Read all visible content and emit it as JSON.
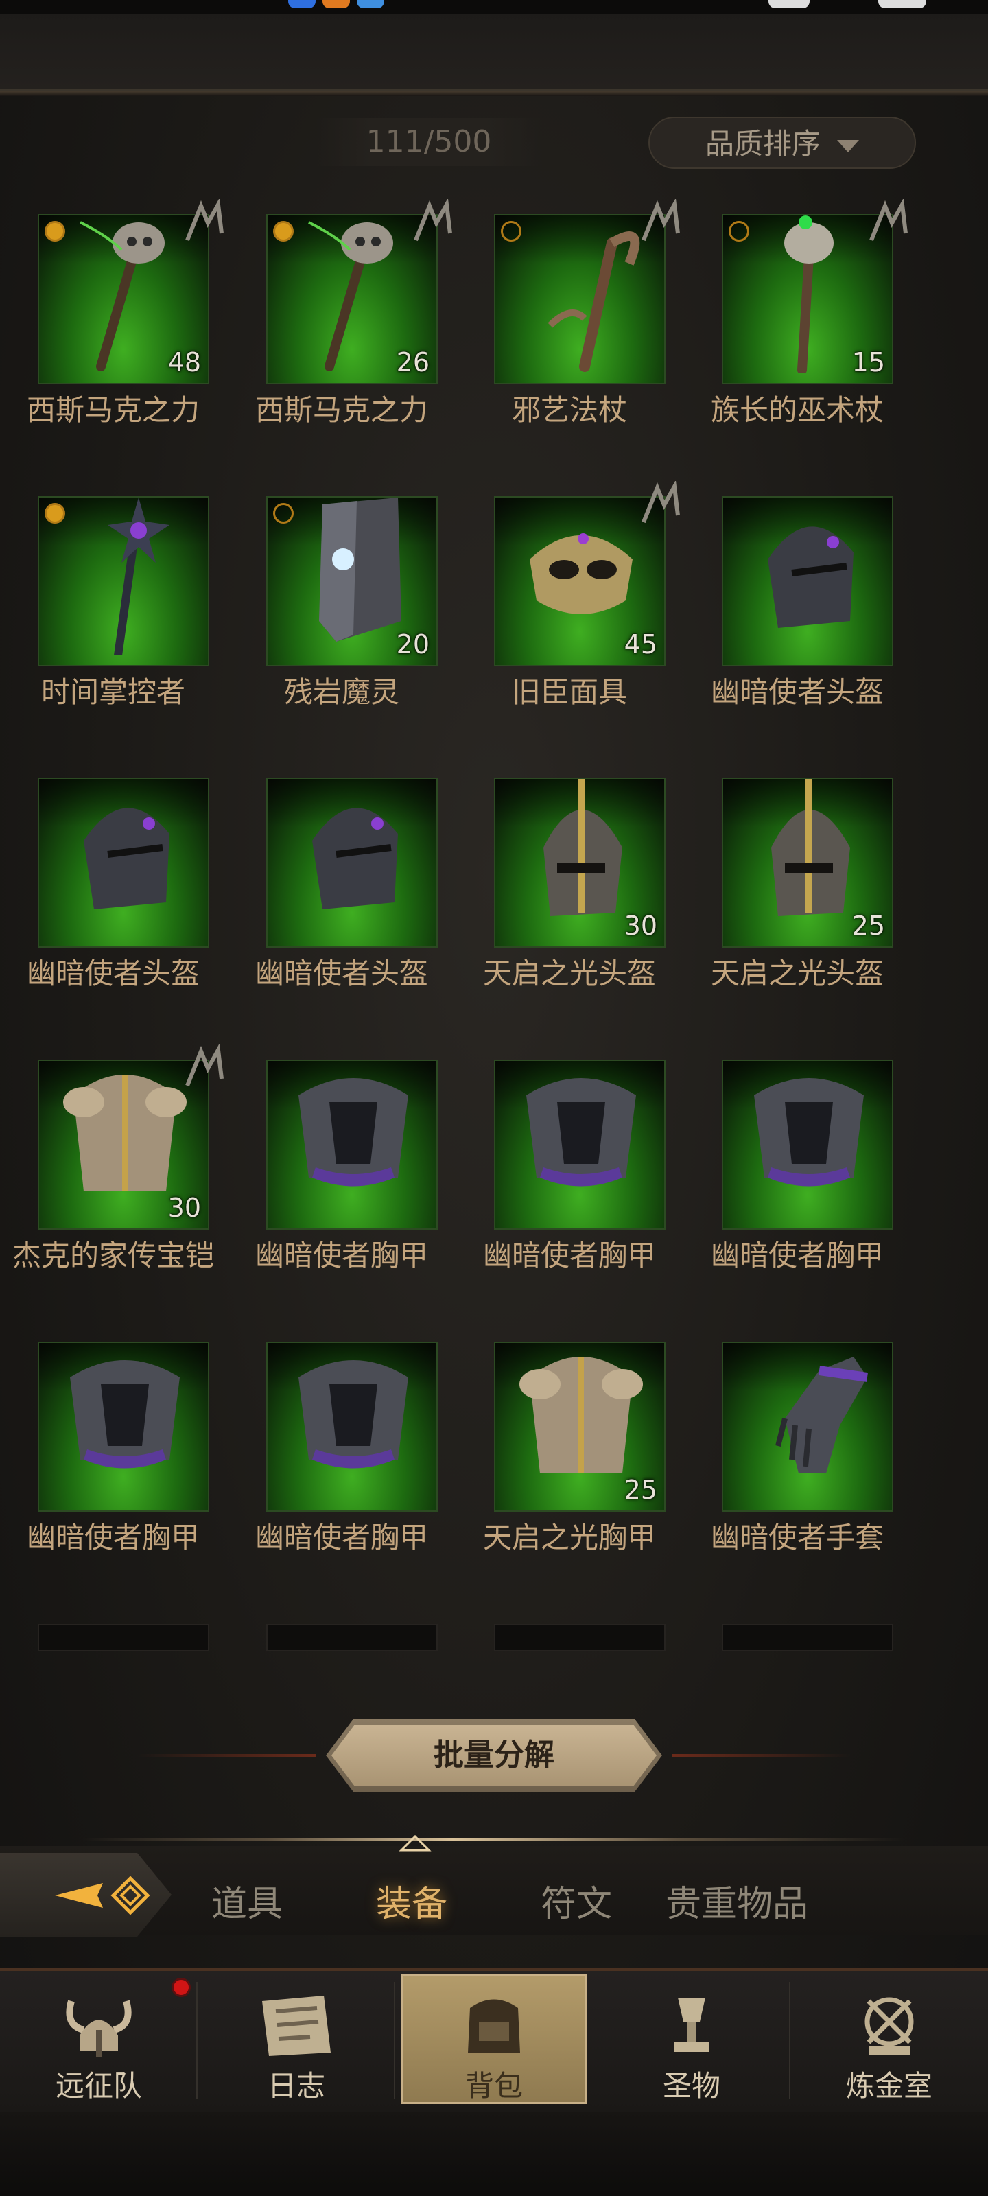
{
  "header": {
    "count_text": "111/500",
    "sort_label": "品质排序"
  },
  "items": [
    {
      "name": "西斯马克之力",
      "level": "48",
      "art": "staff-skull",
      "corner": "filled",
      "rune": true
    },
    {
      "name": "西斯马克之力",
      "level": "26",
      "art": "staff-skull",
      "corner": "filled",
      "rune": true
    },
    {
      "name": "邪艺法杖",
      "level": "",
      "art": "staff-claw",
      "corner": "empty",
      "rune": true
    },
    {
      "name": "族长的巫术杖",
      "level": "15",
      "art": "staff-orb",
      "corner": "empty",
      "rune": true
    },
    {
      "name": "时间掌控者",
      "level": "",
      "art": "staff-star",
      "corner": "filled",
      "rune": false
    },
    {
      "name": "残岩魔灵",
      "level": "20",
      "art": "shield",
      "corner": "empty",
      "rune": false
    },
    {
      "name": "旧臣面具",
      "level": "45",
      "art": "mask",
      "corner": "",
      "rune": true
    },
    {
      "name": "幽暗使者头盔",
      "level": "",
      "art": "helm-dark",
      "corner": "",
      "rune": false
    },
    {
      "name": "幽暗使者头盔",
      "level": "",
      "art": "helm-dark",
      "corner": "",
      "rune": false
    },
    {
      "name": "幽暗使者头盔",
      "level": "",
      "art": "helm-dark",
      "corner": "",
      "rune": false
    },
    {
      "name": "天启之光头盔",
      "level": "30",
      "art": "helm-gold",
      "corner": "",
      "rune": false
    },
    {
      "name": "天启之光头盔",
      "level": "25",
      "art": "helm-gold",
      "corner": "",
      "rune": false
    },
    {
      "name": "杰克的家传宝铠",
      "level": "30",
      "art": "armor-gold",
      "corner": "",
      "rune": true
    },
    {
      "name": "幽暗使者胸甲",
      "level": "",
      "art": "armor-dark",
      "corner": "",
      "rune": false
    },
    {
      "name": "幽暗使者胸甲",
      "level": "",
      "art": "armor-dark",
      "corner": "",
      "rune": false
    },
    {
      "name": "幽暗使者胸甲",
      "level": "",
      "art": "armor-dark",
      "corner": "",
      "rune": false
    },
    {
      "name": "幽暗使者胸甲",
      "level": "",
      "art": "armor-dark",
      "corner": "",
      "rune": false
    },
    {
      "name": "幽暗使者胸甲",
      "level": "",
      "art": "armor-dark",
      "corner": "",
      "rune": false
    },
    {
      "name": "天启之光胸甲",
      "level": "25",
      "art": "armor-gold",
      "corner": "",
      "rune": false
    },
    {
      "name": "幽暗使者手套",
      "level": "",
      "art": "gauntlet",
      "corner": "",
      "rune": false
    }
  ],
  "batch_button": "批量分解",
  "tabs": [
    {
      "label": "道具"
    },
    {
      "label": "装备"
    },
    {
      "label": "符文"
    },
    {
      "label": "贵重物品"
    }
  ],
  "nav": [
    {
      "label": "远征队",
      "icon": "viking-helmet-icon"
    },
    {
      "label": "日志",
      "icon": "scroll-icon"
    },
    {
      "label": "背包",
      "icon": "backpack-icon"
    },
    {
      "label": "圣物",
      "icon": "chalice-icon"
    },
    {
      "label": "炼金室",
      "icon": "alchemy-icon"
    }
  ],
  "colors": {
    "tile_green": "#3fae21",
    "name_text": "#c4a57e",
    "active_tab": "#e0b26a",
    "badge_red": "#d01515"
  }
}
